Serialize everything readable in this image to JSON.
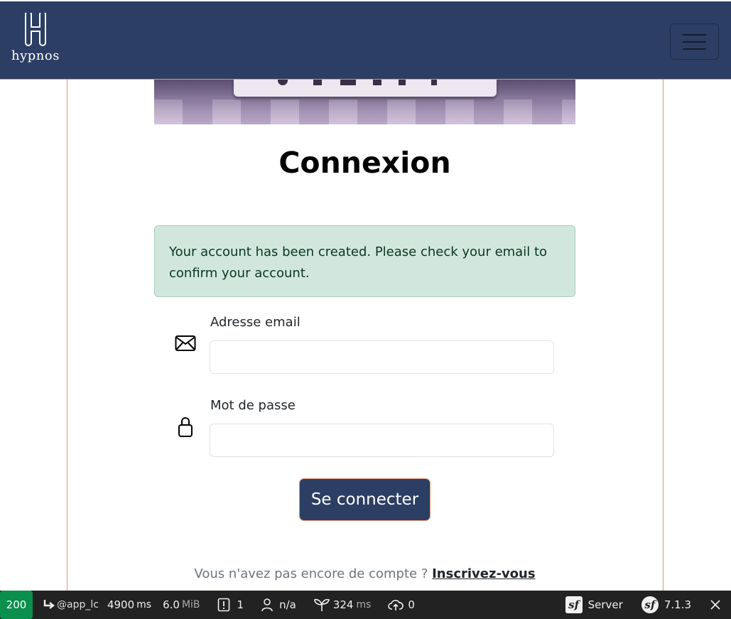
{
  "navbar": {
    "logo_text": "hypnos",
    "menu_icon": "hamburger-icon",
    "colors": {
      "background": "#2c3e63",
      "accent": "#e3946a"
    }
  },
  "main": {
    "title": "Connexion",
    "alert": {
      "message": "Your account has been created. Please check your email to confirm your account.",
      "color": "#d1e7dd"
    },
    "email": {
      "label": "Adresse email",
      "value": "",
      "placeholder": "",
      "icon": "envelope-icon"
    },
    "password": {
      "label": "Mot de passe",
      "value": "",
      "placeholder": "",
      "icon": "lock-icon"
    },
    "submit_label": "Se connecter",
    "signup": {
      "text": "Vous n'avez pas encore de compte ?",
      "link": "Inscrivez-vous"
    }
  },
  "debug_toolbar": {
    "status": "200",
    "route": "@app_lc",
    "time_value": "4900",
    "time_unit": "ms",
    "memory_value": "6.0",
    "memory_unit": "MiB",
    "logs_count": "1",
    "user": "n/a",
    "init_value": "324",
    "init_unit": "ms",
    "ajax_count": "0",
    "server_label": "Server",
    "version": "7.1.3",
    "status_color": "#0a8f4c"
  }
}
